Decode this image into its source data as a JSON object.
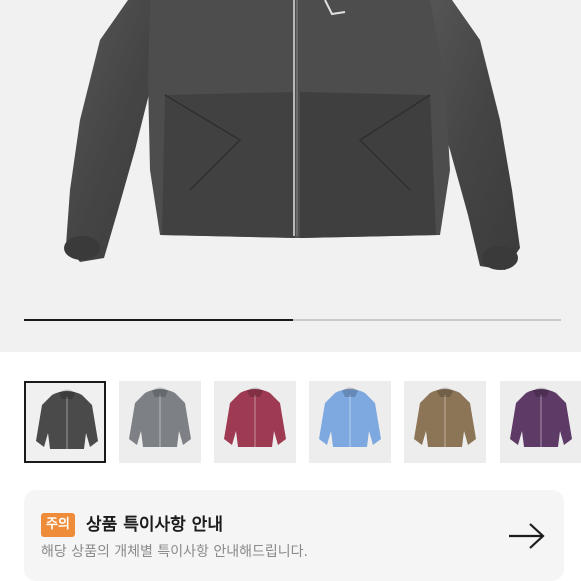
{
  "product": {
    "gallery_progress": 0.5
  },
  "thumbnails": [
    {
      "label": "charcoal",
      "color": "#4a4a4a",
      "selected": true
    },
    {
      "label": "grey",
      "color": "#7d8185",
      "selected": false
    },
    {
      "label": "burgundy",
      "color": "#9e3a52",
      "selected": false
    },
    {
      "label": "sky-blue",
      "color": "#7ea8e0",
      "selected": false
    },
    {
      "label": "brown",
      "color": "#8c7457",
      "selected": false
    },
    {
      "label": "purple",
      "color": "#5e3a66",
      "selected": false
    }
  ],
  "notice": {
    "badge": "주의",
    "title": "상품 특이사항 안내",
    "description": "해당 상품의 개체별 특이사항 안내해드립니다.",
    "arrow_icon": "arrow-right-icon"
  },
  "colors": {
    "badge_bg": "#ef8c3a",
    "jacket_main": "#4c4c4c"
  }
}
